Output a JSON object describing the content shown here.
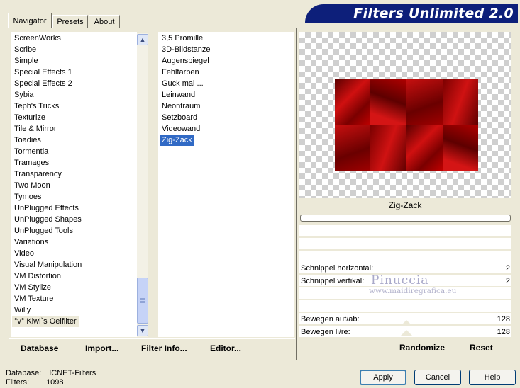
{
  "tabs": [
    {
      "label": "Navigator"
    },
    {
      "label": "Presets"
    },
    {
      "label": "About"
    }
  ],
  "title": "Filters Unlimited 2.0",
  "categories": [
    "ScreenWorks",
    "Scribe",
    "Simple",
    "Special Effects 1",
    "Special Effects 2",
    "Sybia",
    "Teph's Tricks",
    "Texturize",
    "Tile & Mirror",
    "Toadies",
    "Tormentia",
    "Tramages",
    "Transparency",
    "Two Moon",
    "Tymoes",
    "UnPlugged Effects",
    "UnPlugged Shapes",
    "UnPlugged Tools",
    "Variations",
    "Video",
    "Visual Manipulation",
    "VM Distortion",
    "VM Stylize",
    "VM Texture",
    "Willy",
    "°v° Kiwi`s Oelfilter"
  ],
  "filters": [
    "3,5 Promille",
    "3D-Bildstanze",
    "Augenspiegel",
    "Fehlfarben",
    "Guck mal ...",
    "Leinwand",
    "Neontraum",
    "Setzboard",
    "Videowand",
    "Zig-Zack"
  ],
  "selected_filter": "Zig-Zack",
  "selected_category": "°v° Kiwi`s Oelfilter",
  "left_buttons": {
    "database": "Database",
    "import": "Import...",
    "filter_info": "Filter Info...",
    "editor": "Editor..."
  },
  "preview": {
    "filter_name": "Zig-Zack"
  },
  "params": [
    {
      "label": "Schnippel horizontal:",
      "value": "2"
    },
    {
      "label": "Schnippel vertikal:",
      "value": "2"
    },
    {
      "label": "Bewegen auf/ab:",
      "value": "128"
    },
    {
      "label": "Bewegen li/re:",
      "value": "128"
    }
  ],
  "watermark": {
    "name": "Pinuccia",
    "site": "www.maidiregrafica.eu"
  },
  "right_buttons": {
    "randomize": "Randomize",
    "reset": "Reset"
  },
  "dialog_buttons": {
    "apply": "Apply",
    "cancel": "Cancel",
    "help": "Help"
  },
  "status": {
    "database_label": "Database:",
    "database_value": "ICNET-Filters",
    "filters_label": "Filters:",
    "filters_value": "1098"
  },
  "colors": {
    "banner": "#0d1f7a",
    "selection": "#316ac5",
    "image_red": "#8a0000"
  }
}
